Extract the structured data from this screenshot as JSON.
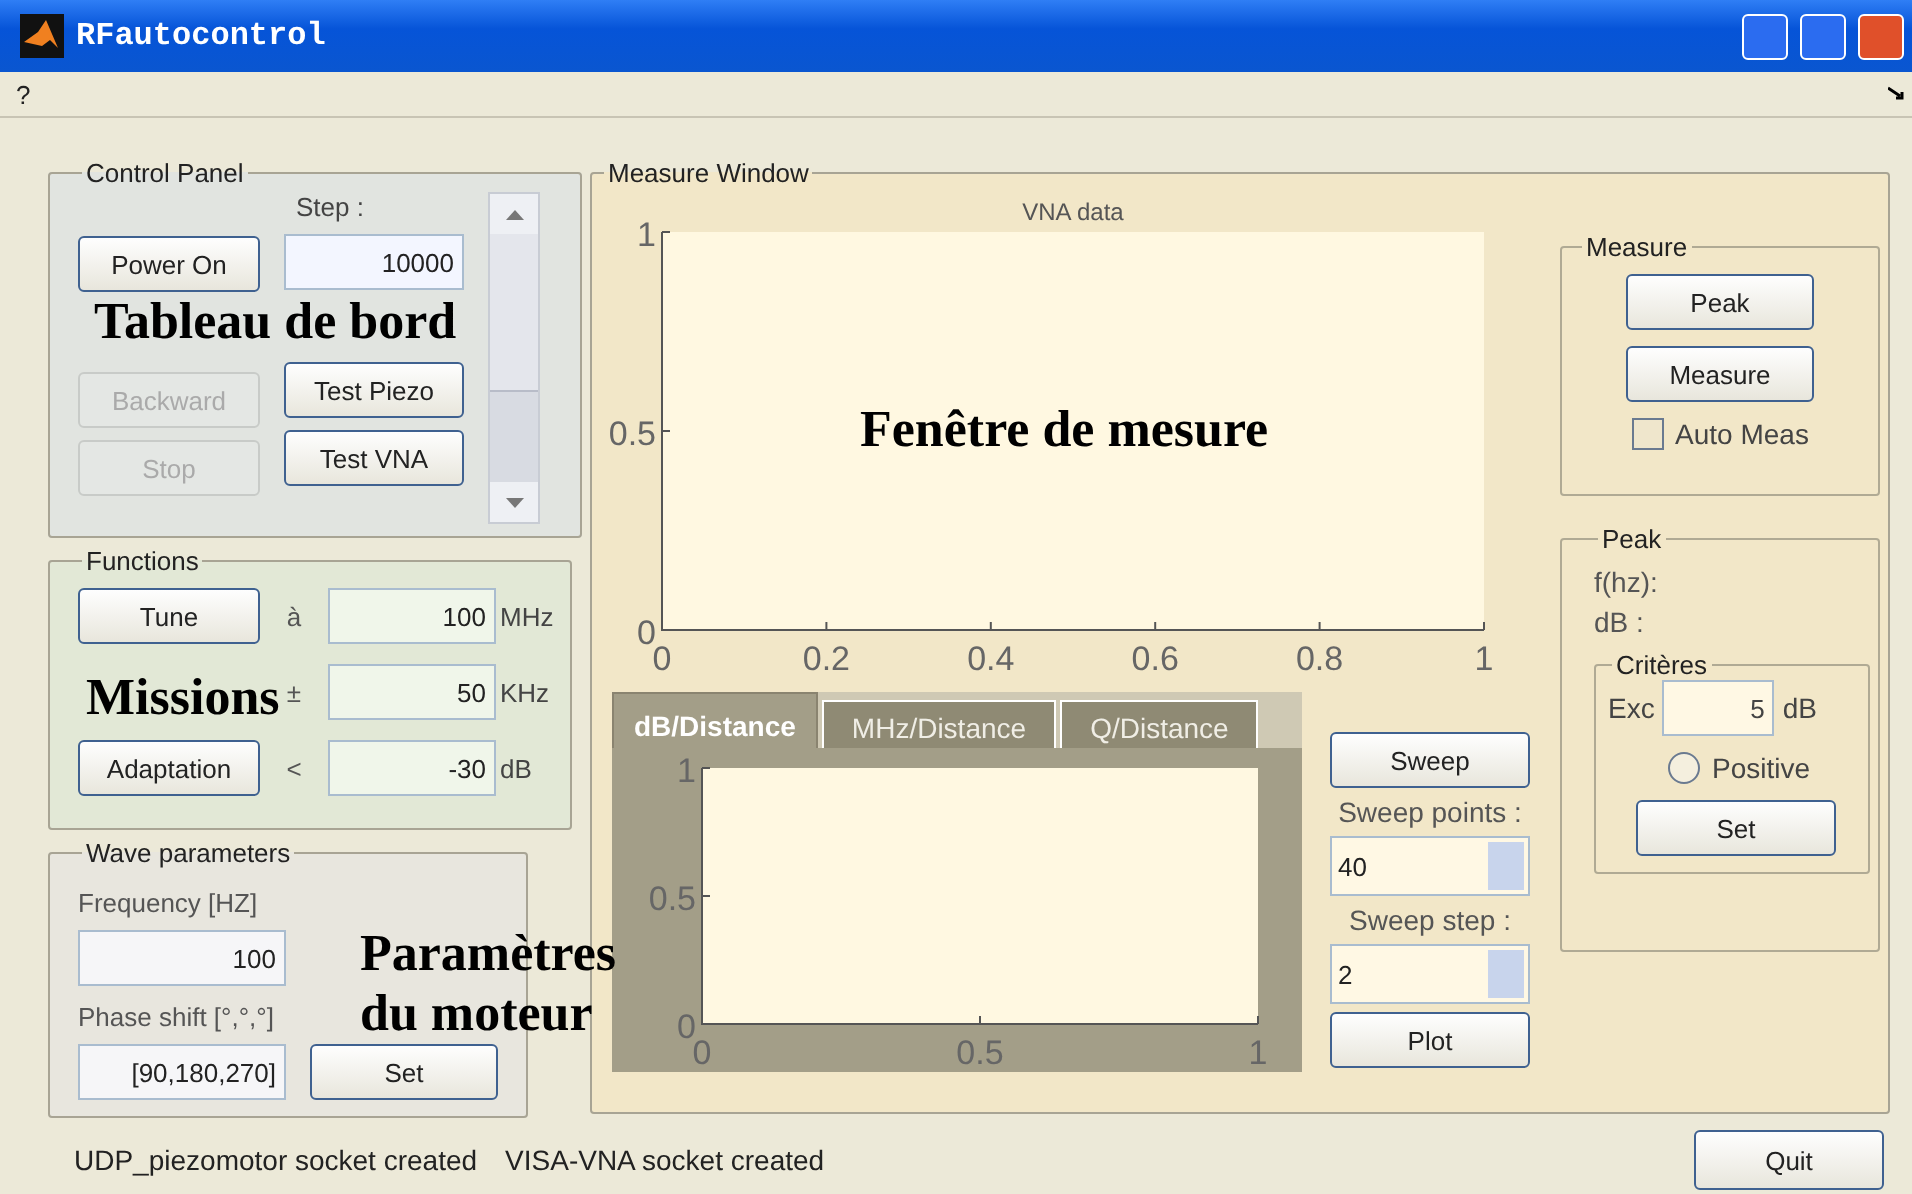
{
  "window": {
    "title": "RFautocontrol"
  },
  "menu_bar": {
    "items": [
      "?"
    ]
  },
  "control_panel": {
    "title": "Control Panel",
    "step_label": "Step :",
    "step_value": "10000",
    "left_buttons": [
      {
        "label": "Power On",
        "disabled": false
      },
      {
        "label": "Backward",
        "disabled": true
      },
      {
        "label": "Stop",
        "disabled": true
      }
    ],
    "right_buttons": [
      {
        "label": "Test Piezo",
        "disabled": false
      },
      {
        "label": "Test VNA",
        "disabled": false
      }
    ]
  },
  "functions": {
    "title": "Functions",
    "rows": [
      {
        "button": "Tune",
        "symbol": "à",
        "value": "100",
        "unit": "MHz"
      },
      {
        "symbol": "±",
        "value": "50",
        "unit": "KHz"
      },
      {
        "button": "Adaptation",
        "symbol": "<",
        "value": "-30",
        "unit": "dB"
      }
    ]
  },
  "wave_parameters": {
    "title": "Wave parameters",
    "rows": [
      {
        "label": "Frequency [HZ]",
        "value": "100"
      },
      {
        "label": "Phase shift [°,°,°]",
        "value": "[90,180,270]",
        "button": "Set"
      }
    ]
  },
  "measure_window": {
    "title": "Measure Window",
    "chart_data": {
      "type": "line",
      "title": "VNA data",
      "xlim": [
        0,
        1
      ],
      "ylim": [
        0,
        1
      ],
      "xticks": [
        0,
        0.2,
        0.4,
        0.6,
        0.8,
        1
      ],
      "yticks": [
        0,
        0.5,
        1
      ]
    },
    "tabs": [
      {
        "label": "dB/Distance",
        "selected": true
      },
      {
        "label": "MHz/Distance",
        "selected": false
      },
      {
        "label": "Q/Distance",
        "selected": false
      }
    ],
    "tab_chart": {
      "chart_data": {
        "type": "line",
        "xlim": [
          0,
          1
        ],
        "ylim": [
          0,
          1
        ],
        "xticks": [
          0,
          0.5,
          1
        ],
        "yticks": [
          0,
          0.5,
          1
        ]
      }
    },
    "sweep": {
      "button": "Sweep",
      "points_label": "Sweep points :",
      "points_value": "40",
      "step_label": "Sweep step :",
      "step_value": "2",
      "plot_button": "Plot"
    },
    "measure_group": {
      "title": "Measure",
      "buttons": [
        "Peak",
        "Measure"
      ],
      "auto_meas": {
        "label": "Auto Meas",
        "checked": false
      }
    },
    "peak_group": {
      "title": "Peak",
      "f_label": "f(hz):",
      "db_label": "dB :",
      "criteria": {
        "title": "Critères",
        "exc_label": "Exc",
        "exc_value": "5",
        "unit": "dB",
        "positive": {
          "label": "Positive",
          "selected": false
        },
        "button": "Set"
      }
    }
  },
  "status_bar": {
    "messages": [
      "UDP_piezomotor socket created",
      "VISA-VNA socket created"
    ]
  },
  "quit_button": "Quit",
  "annotations": [
    {
      "kind": "control",
      "lines": [
        "Tableau de bord"
      ]
    },
    {
      "kind": "functions",
      "lines": [
        "Missions"
      ]
    },
    {
      "kind": "motor",
      "lines": [
        "Paramètres",
        "du moteur"
      ]
    },
    {
      "kind": "measure",
      "lines": [
        "Fenêtre de mesure"
      ]
    }
  ]
}
